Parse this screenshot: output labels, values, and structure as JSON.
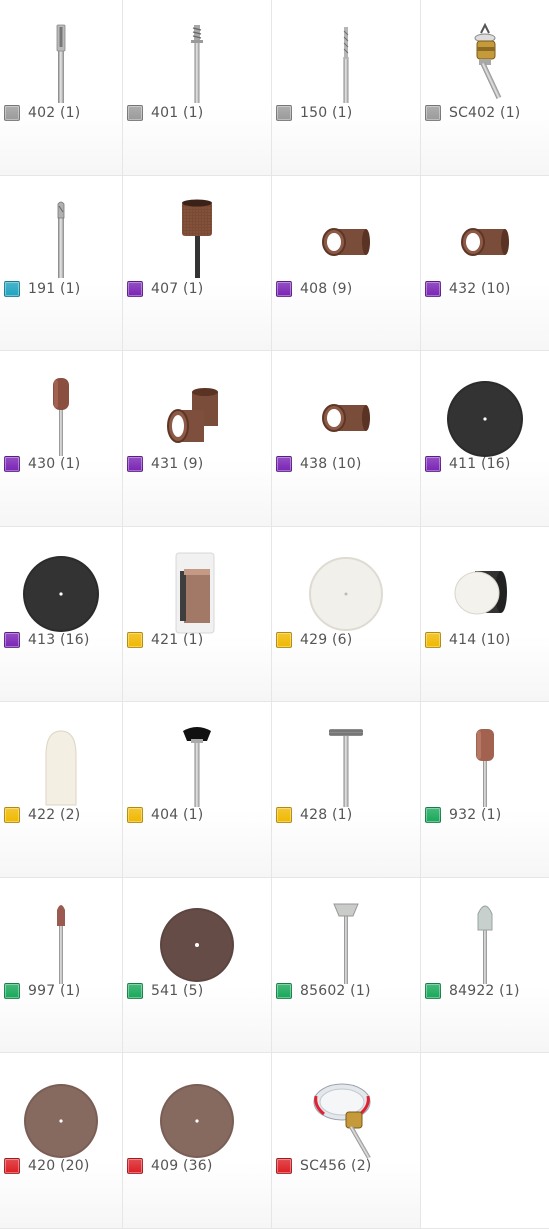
{
  "colors": {
    "gray": "#9a9a9a",
    "cyan": "#1fa3bf",
    "purple": "#7a24b5",
    "yellow": "#f0b800",
    "green": "#18a85a",
    "red": "#db1f24"
  },
  "items": [
    {
      "label": "402 (1)",
      "color": "gray",
      "icon": "mandrel-icon"
    },
    {
      "label": "401 (1)",
      "color": "gray",
      "icon": "screw-mandrel-icon"
    },
    {
      "label": "150 (1)",
      "color": "gray",
      "icon": "drill-bit-icon"
    },
    {
      "label": "SC402 (1)",
      "color": "gray",
      "icon": "speedclic-mandrel-icon"
    },
    {
      "label": "191 (1)",
      "color": "cyan",
      "icon": "cutter-bit-icon"
    },
    {
      "label": "407 (1)",
      "color": "purple",
      "icon": "sanding-drum-icon"
    },
    {
      "label": "408 (9)",
      "color": "purple",
      "icon": "sanding-band-icon"
    },
    {
      "label": "432 (10)",
      "color": "purple",
      "icon": "sanding-band-icon"
    },
    {
      "label": "430 (1)",
      "color": "purple",
      "icon": "small-sanding-drum-icon"
    },
    {
      "label": "431 (9)",
      "color": "purple",
      "icon": "sanding-bands-icon"
    },
    {
      "label": "438 (10)",
      "color": "purple",
      "icon": "sanding-band-icon"
    },
    {
      "label": "411 (16)",
      "color": "purple",
      "icon": "black-disc-icon"
    },
    {
      "label": "413 (16)",
      "color": "purple",
      "icon": "black-disc-icon"
    },
    {
      "label": "421 (1)",
      "color": "yellow",
      "icon": "polishing-compound-icon"
    },
    {
      "label": "429 (6)",
      "color": "yellow",
      "icon": "felt-wheel-icon"
    },
    {
      "label": "414 (10)",
      "color": "yellow",
      "icon": "felt-wheels-icon"
    },
    {
      "label": "422 (2)",
      "color": "yellow",
      "icon": "felt-tip-icon"
    },
    {
      "label": "404 (1)",
      "color": "yellow",
      "icon": "bristle-brush-icon"
    },
    {
      "label": "428 (1)",
      "color": "yellow",
      "icon": "wire-brush-icon"
    },
    {
      "label": "932 (1)",
      "color": "green",
      "icon": "grinding-stone-icon"
    },
    {
      "label": "997 (1)",
      "color": "green",
      "icon": "engraving-point-icon"
    },
    {
      "label": "541 (5)",
      "color": "green",
      "icon": "cutoff-wheel-icon"
    },
    {
      "label": "85602 (1)",
      "color": "green",
      "icon": "wheel-point-icon"
    },
    {
      "label": "84922 (1)",
      "color": "green",
      "icon": "grinding-point-icon"
    },
    {
      "label": "420 (20)",
      "color": "red",
      "icon": "cutting-disc-icon"
    },
    {
      "label": "409 (36)",
      "color": "red",
      "icon": "cutting-disc-icon"
    },
    {
      "label": "SC456 (2)",
      "color": "red",
      "icon": "speedclic-wheel-icon"
    }
  ]
}
